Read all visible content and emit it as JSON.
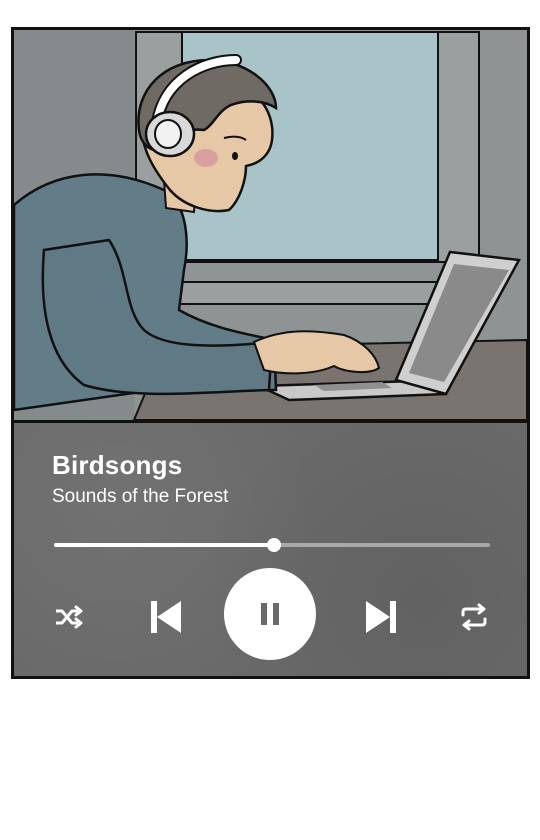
{
  "track": {
    "title": "Birdsongs",
    "artist": "Sounds of the Forest"
  },
  "playback": {
    "progress_fraction": 0.505,
    "state": "playing"
  },
  "controls": {
    "shuffle_icon": "shuffle-icon",
    "previous_icon": "skip-previous-icon",
    "play_pause_icon": "pause-icon",
    "next_icon": "skip-next-icon",
    "repeat_icon": "repeat-icon"
  },
  "colors": {
    "panel": "#6a6a6a",
    "accent": "#ffffff",
    "track": "#a9a9a9",
    "icon_dark": "#6a6a6a"
  }
}
